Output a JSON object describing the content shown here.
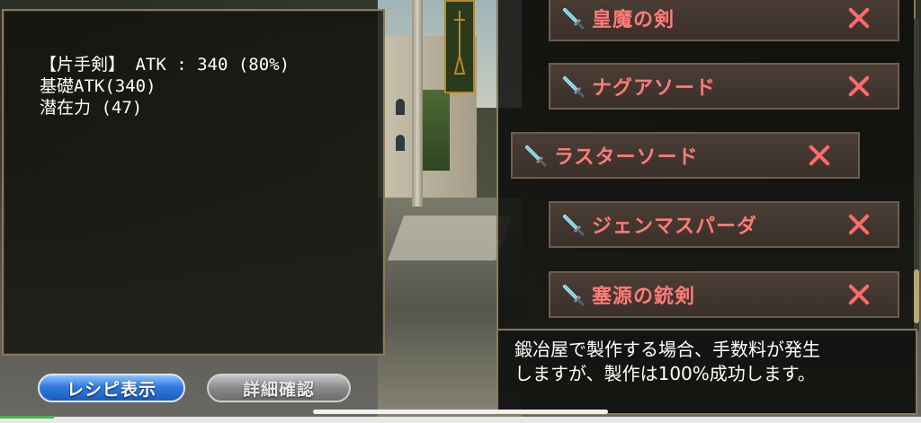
{
  "info": {
    "line1": "【片手剣】 ATK : 340 (80%)",
    "line2": "基礎ATK(340)",
    "line3": "潜在力 (47)"
  },
  "buttons": {
    "recipe": "レシピ表示",
    "detail": "詳細確認"
  },
  "items": [
    {
      "name": "皇魔の剣",
      "icon": "sword-icon",
      "action": "close-icon"
    },
    {
      "name": "ナグアソード",
      "icon": "sword-icon",
      "action": "close-icon"
    },
    {
      "name": "ラスターソード",
      "icon": "sword-icon",
      "action": "close-icon",
      "selected": true
    },
    {
      "name": "ジェンマスパーダ",
      "icon": "sword-icon",
      "action": "close-icon"
    },
    {
      "name": "塞源の銃剣",
      "icon": "sword-icon",
      "action": "close-icon"
    }
  ],
  "description": {
    "line1": "鍛冶屋で製作する場合、手数料が発生",
    "line2": "しますが、製作は100%成功します。"
  },
  "colors": {
    "item_text": "#ff7b78",
    "x_mark": "#ff6a6a",
    "recipe_button": "#2f7be0",
    "frame": "#8a7a5c"
  }
}
